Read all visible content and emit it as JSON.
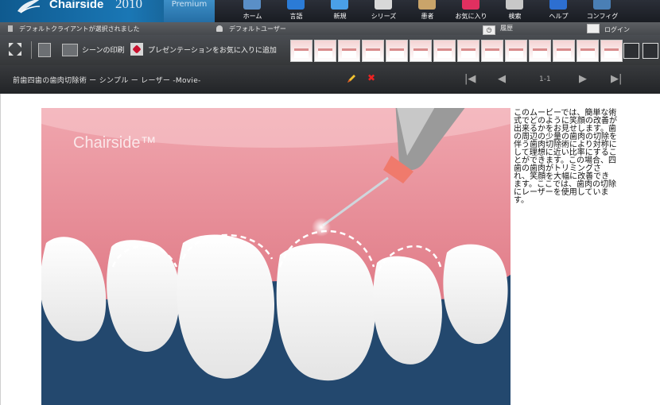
{
  "app": {
    "name": "Chairside",
    "year": "2010",
    "edition": "Premium"
  },
  "nav": [
    {
      "label": "ホーム",
      "icon": "home-icon",
      "color": "#5a8fc7"
    },
    {
      "label": "言語",
      "icon": "language-icon",
      "color": "#2b7bd6"
    },
    {
      "label": "新規",
      "icon": "new-icon",
      "color": "#4aa0e8"
    },
    {
      "label": "シリーズ",
      "icon": "series-icon",
      "color": "#d8d8d8"
    },
    {
      "label": "患者",
      "icon": "patient-icon",
      "color": "#c9a46a"
    },
    {
      "label": "お気に入り",
      "icon": "favorites-icon",
      "color": "#e03060"
    },
    {
      "label": "検索",
      "icon": "search-icon",
      "color": "#c8c8c8"
    },
    {
      "label": "ヘルプ",
      "icon": "help-icon",
      "color": "#2d6fd1"
    },
    {
      "label": "コンフィグ",
      "icon": "config-icon",
      "color": "#4a7fb5"
    }
  ],
  "status": {
    "client": "デフォルトクライアントが選択されました",
    "user": "デフォルトユーザー",
    "history": "履歴",
    "login": "ログイン"
  },
  "toolbar": {
    "print_label": "シーンの印刷",
    "favorite_label": "プレゼンテーションをお気に入りに追加",
    "thumbnail_count": 14
  },
  "title": {
    "text": "前歯四歯の歯肉切除術 ー シンプル ー レーザー -Movie-",
    "page": "1-1"
  },
  "video": {
    "watermark": "Chairside™"
  },
  "description": "このムービーでは、簡単な術式でどのように笑顔の改善が出来るかをお見せします。歯の周辺の少量の歯肉の切除を伴う歯肉切除術により対称にして理想に近い比率にすることができます。この場合、四歯の歯肉がトリミングされ、笑顔を大幅に改善できます。ここでは、歯肉の切除にレーザーを使用しています。",
  "colors": {
    "gum": "#e68a95",
    "background": "#23486e",
    "accent": "#e22222"
  }
}
